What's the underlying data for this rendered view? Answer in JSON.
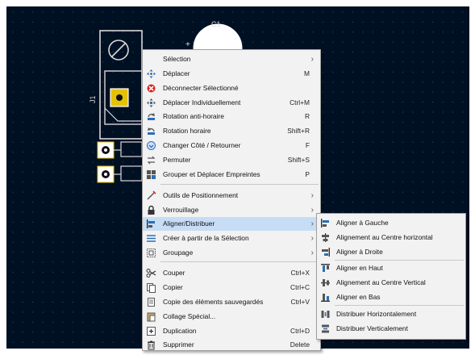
{
  "pcb": {
    "component_ref_c1": "C1",
    "component_ref_j1": "J1",
    "background_color": "#001023",
    "grid_color": "#4b5a72"
  },
  "context_menu": {
    "items": [
      {
        "label": "Sélection",
        "shortcut": "",
        "submenu": true,
        "icon": "none"
      },
      {
        "label": "Déplacer",
        "shortcut": "M",
        "submenu": false,
        "icon": "move-arrows-icon"
      },
      {
        "label": "Déconnecter Sélectionné",
        "shortcut": "",
        "submenu": false,
        "icon": "disconnect-icon"
      },
      {
        "label": "Déplacer Individuellement",
        "shortcut": "Ctrl+M",
        "submenu": false,
        "icon": "move-individually-icon"
      },
      {
        "label": "Rotation anti-horaire",
        "shortcut": "R",
        "submenu": false,
        "icon": "rotate-ccw-icon"
      },
      {
        "label": "Rotation horaire",
        "shortcut": "Shift+R",
        "submenu": false,
        "icon": "rotate-cw-icon"
      },
      {
        "label": "Changer Côté / Retourner",
        "shortcut": "F",
        "submenu": false,
        "icon": "flip-icon"
      },
      {
        "label": "Permuter",
        "shortcut": "Shift+S",
        "submenu": false,
        "icon": "swap-icon"
      },
      {
        "label": "Grouper et Déplacer Empreintes",
        "shortcut": "P",
        "submenu": false,
        "icon": "pack-footprints-icon"
      },
      {
        "label": "Outils de Positionnement",
        "shortcut": "",
        "submenu": true,
        "icon": "positioning-tools-icon"
      },
      {
        "label": "Verrouillage",
        "shortcut": "",
        "submenu": true,
        "icon": "lock-icon"
      },
      {
        "label": "Aligner/Distribuer",
        "shortcut": "",
        "submenu": true,
        "icon": "align-icon",
        "highlighted": true
      },
      {
        "label": "Créer à partir de la Sélection",
        "shortcut": "",
        "submenu": true,
        "icon": "create-from-selection-icon"
      },
      {
        "label": "Groupage",
        "shortcut": "",
        "submenu": true,
        "icon": "group-icon"
      },
      {
        "label": "Couper",
        "shortcut": "Ctrl+X",
        "submenu": false,
        "icon": "scissors-icon"
      },
      {
        "label": "Copier",
        "shortcut": "Ctrl+C",
        "submenu": false,
        "icon": "copy-icon"
      },
      {
        "label": "Copie des éléments sauvegardés",
        "shortcut": "Ctrl+V",
        "submenu": false,
        "icon": "copy-saved-icon"
      },
      {
        "label": "Collage Spécial...",
        "shortcut": "",
        "submenu": false,
        "icon": "paste-special-icon"
      },
      {
        "label": "Duplication",
        "shortcut": "Ctrl+D",
        "submenu": false,
        "icon": "duplicate-icon"
      },
      {
        "label": "Supprimer",
        "shortcut": "Delete",
        "submenu": false,
        "icon": "trash-icon"
      }
    ]
  },
  "align_submenu": {
    "items": [
      {
        "label": "Aligner à Gauche",
        "icon": "align-left-icon"
      },
      {
        "label": "Alignement au Centre horizontal",
        "icon": "align-center-horizontal-icon"
      },
      {
        "label": "Aligner à Droite",
        "icon": "align-right-icon"
      },
      {
        "label": "Aligner en Haut",
        "icon": "align-top-icon"
      },
      {
        "label": "Alignement au Centre Vertical",
        "icon": "align-center-vertical-icon"
      },
      {
        "label": "Aligner en Bas",
        "icon": "align-bottom-icon"
      },
      {
        "label": "Distribuer Horizontalement",
        "icon": "distribute-horizontal-icon"
      },
      {
        "label": "Distribuer Verticalement",
        "icon": "distribute-vertical-icon"
      }
    ]
  }
}
